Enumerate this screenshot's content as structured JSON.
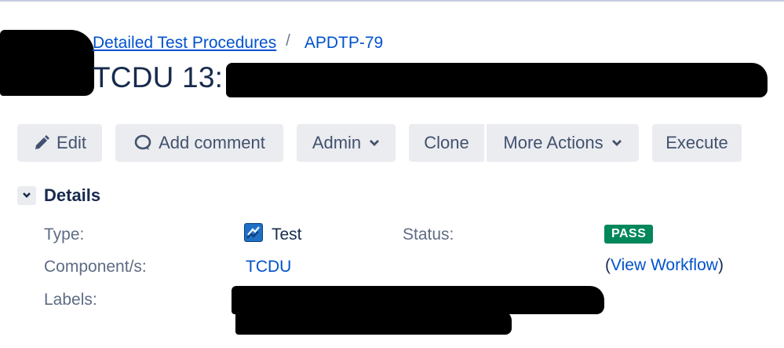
{
  "breadcrumb": {
    "project": "Detailed Test Procedures",
    "separator": "/",
    "issue_key": "APDTP-79"
  },
  "issue": {
    "title_prefix": "TCDU 13:"
  },
  "toolbar": {
    "edit": "Edit",
    "add_comment": "Add comment",
    "admin": "Admin",
    "clone": "Clone",
    "more_actions": "More Actions",
    "execute": "Execute"
  },
  "details": {
    "heading": "Details",
    "type_label": "Type:",
    "type_value": "Test",
    "type_icon": "test-issue-type-icon",
    "status_label": "Status:",
    "status_value": "PASS",
    "status_color": "#00875a",
    "view_workflow": "View Workflow",
    "paren_open": "(",
    "paren_close": ")",
    "components_label": "Component/s:",
    "components_value": "TCDU",
    "labels_label": "Labels:"
  },
  "colors": {
    "link": "#0052cc",
    "button_bg": "#ebecf0",
    "text": "#172b4d"
  }
}
